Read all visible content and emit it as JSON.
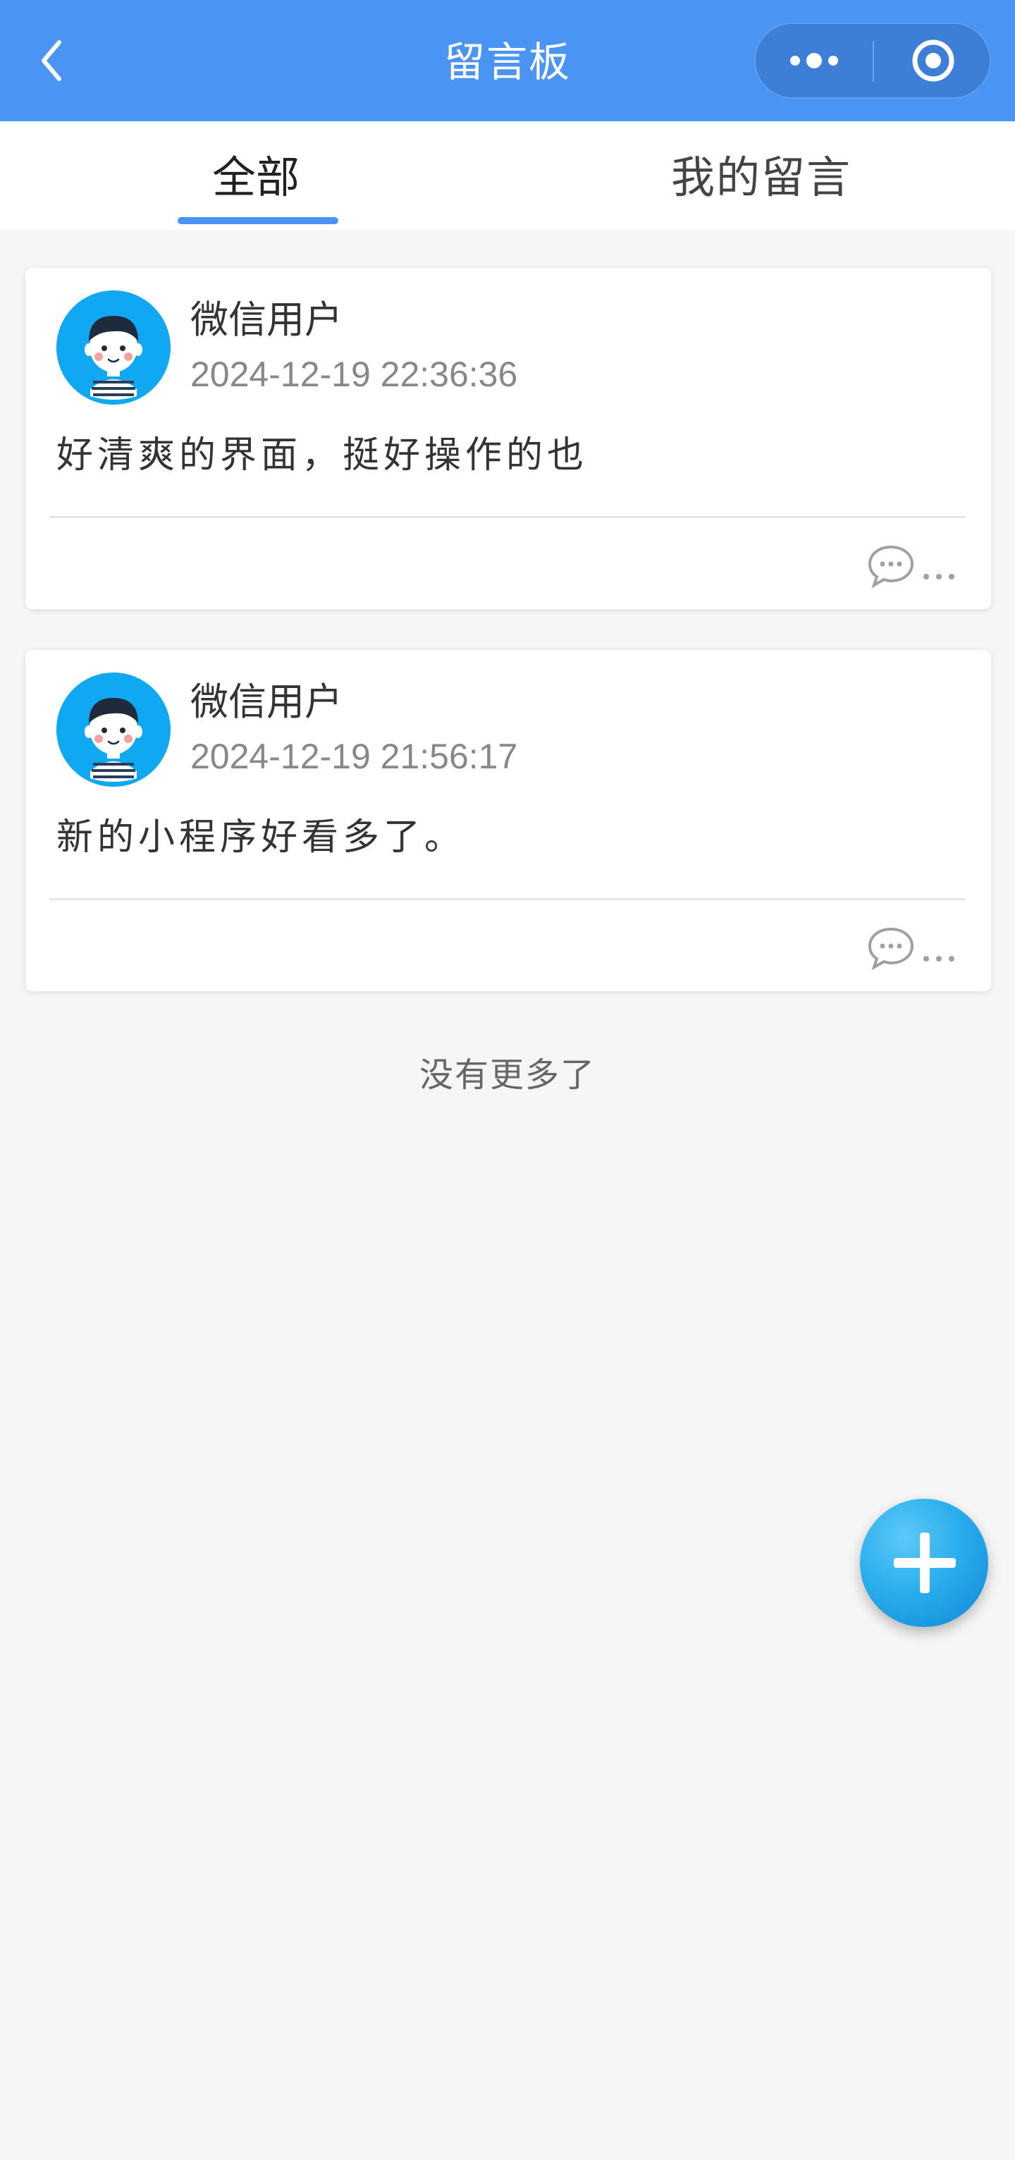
{
  "navbar": {
    "title": "留言板",
    "color": "#4a94f3"
  },
  "tabs": [
    {
      "label": "全部",
      "active": true
    },
    {
      "label": "我的留言",
      "active": false
    }
  ],
  "messages": [
    {
      "username": "微信用户",
      "time": "2024-12-19 22:36:36",
      "content": "好清爽的界面，挺好操作的也"
    },
    {
      "username": "微信用户",
      "time": "2024-12-19 21:56:17",
      "content": "新的小程序好看多了。"
    }
  ],
  "footer": {
    "no_more": "没有更多了"
  },
  "icons": {
    "back": "chevron-left-icon",
    "more": "more-dots-icon",
    "close": "target-circle-icon",
    "comment": "comment-bubble-icon",
    "ellipsis": "ellipsis-icon",
    "add": "plus-icon"
  }
}
